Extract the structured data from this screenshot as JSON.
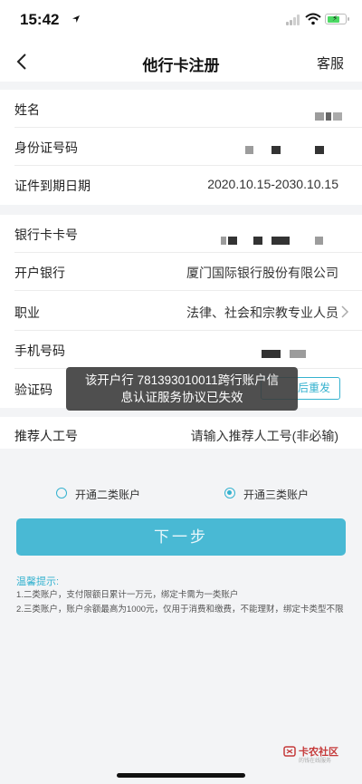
{
  "status": {
    "time": "15:42"
  },
  "nav": {
    "title": "他行卡注册",
    "service": "客服"
  },
  "fields": {
    "name_label": "姓名",
    "id_label": "身份证号码",
    "expiry_label": "证件到期日期",
    "expiry_value": "2020.10.15-2030.10.15",
    "card_label": "银行卡卡号",
    "bank_label": "开户银行",
    "bank_value": "厦门国际银行股份有限公司",
    "job_label": "职业",
    "job_value": "法律、社会和宗教专业人员",
    "phone_label": "手机号码",
    "code_label": "验证码",
    "resend_label": "后重发",
    "referrer_label": "推荐人工号",
    "referrer_placeholder": "请输入推荐人工号(非必输)"
  },
  "toast": {
    "line1": "该开户行 781393010011跨行账户信",
    "line2": "息认证服务协议已失效"
  },
  "options": [
    {
      "label": "开通二类账户",
      "selected": false
    },
    {
      "label": "开通三类账户",
      "selected": true
    }
  ],
  "next_button": "下一步",
  "tips": {
    "title": "温馨提示:",
    "line1": "1.二类账户，支付限额日累计一万元，绑定卡需为一类账户",
    "line2": "2.三类账户，账户余额最高为1000元，仅用于消费和缴费，不能理财，绑定卡类型不限"
  },
  "watermark": {
    "title": "卡农社区",
    "subtitle": "的钱在线服务"
  },
  "colors": {
    "accent": "#35b2cf",
    "button": "#49b9d4",
    "toast_bg": "#3c3c3c"
  }
}
